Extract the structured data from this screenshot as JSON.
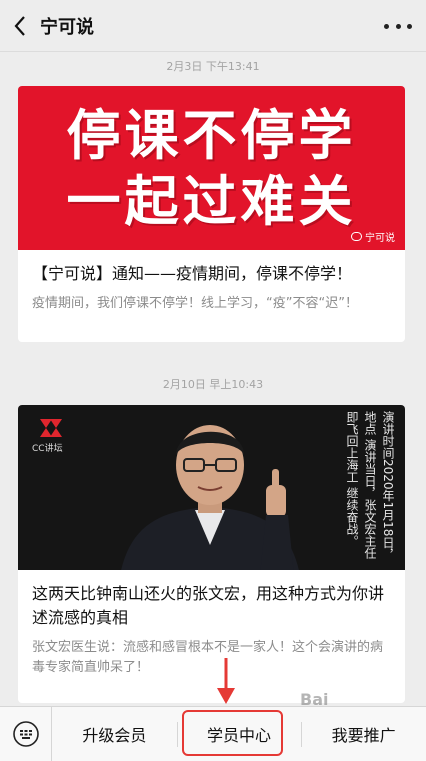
{
  "header": {
    "title": "宁可说"
  },
  "feed": {
    "messages": [
      {
        "timestamp": "2月3日 下午13:41",
        "banner_lines": [
          "停课不停学",
          "一起过难关"
        ],
        "banner_watermark": "宁可说",
        "title": "【宁可说】通知——疫情期间，停课不停学！",
        "description": "疫情期间，我们停课不停学！线上学习，“疫”不容“迟”！"
      },
      {
        "timestamp": "2月10日 早上10:43",
        "video_logo": "CC讲坛",
        "video_caption": "演讲时间2020年1月18日，地点 演讲当日，张文宏主任即飞回上海工 继续奋战。",
        "title": "这两天比钟南山还火的张文宏，用这种方式为你讲述流感的真相",
        "description": "张文宏医生说：流感和感冒根本不是一家人！这个会演讲的病毒专家简直帅呆了！"
      }
    ]
  },
  "bottom_menu": {
    "items": [
      "升级会员",
      "学员中心",
      "我要推广"
    ],
    "highlight_color": "#e53935"
  },
  "watermark": "Bai"
}
